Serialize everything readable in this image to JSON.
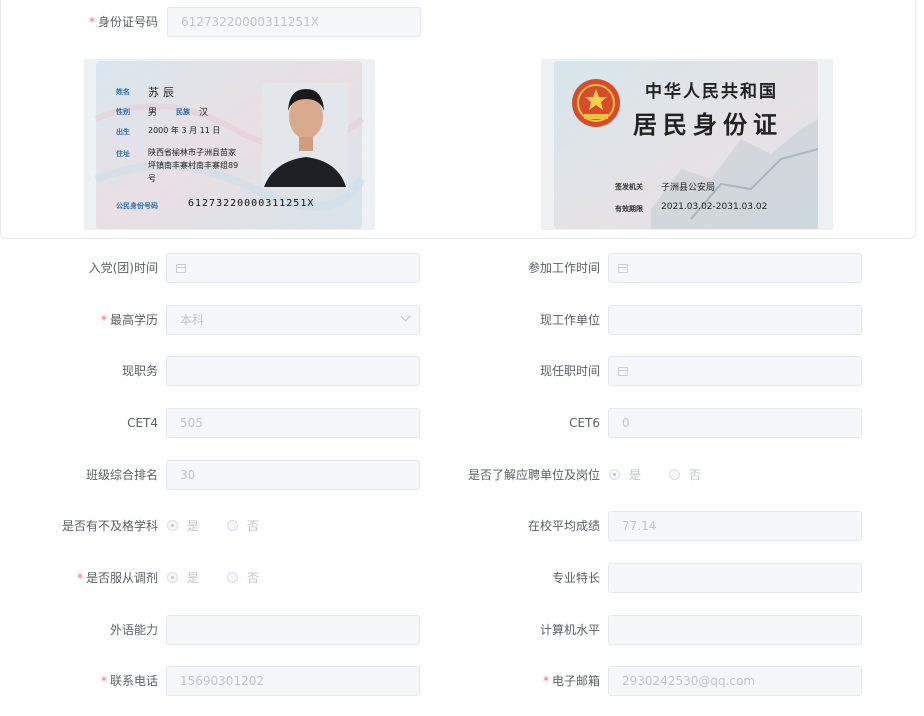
{
  "id_section": {
    "label": "身份证号码",
    "required": "*",
    "value": "61273220000311251X",
    "front": {
      "name_label": "姓名",
      "name": "苏辰",
      "gender_label": "性别",
      "gender": "男",
      "ethnic_label": "民族",
      "ethnic": "汉",
      "birth_label": "出生",
      "birth": "2000 年 3 月 11 日",
      "address_label": "住址",
      "address_1": "陕西省榆林市子洲县苗家",
      "address_2": "坪镇南丰寨村南丰寨组89",
      "address_3": "号",
      "idno_label": "公民身份号码",
      "idno": "61273220000311251X"
    },
    "back": {
      "title_1": "中华人民共和国",
      "title_2": "居民身份证",
      "issuer_label": "签发机关",
      "issuer": "子洲县公安局",
      "valid_label": "有效期限",
      "valid": "2021.03.02-2031.03.02"
    }
  },
  "form": {
    "join_party_time": {
      "label": "入党(团)时间",
      "value": ""
    },
    "work_start_time": {
      "label": "参加工作时间",
      "value": ""
    },
    "education": {
      "label": "最高学历",
      "required": "*",
      "value": "本科"
    },
    "current_employer": {
      "label": "现工作单位",
      "value": ""
    },
    "current_position": {
      "label": "现职务",
      "value": ""
    },
    "position_time": {
      "label": "现任职时间",
      "value": ""
    },
    "cet4": {
      "label": "CET4",
      "value": "505"
    },
    "cet6": {
      "label": "CET6",
      "value": "0"
    },
    "class_rank": {
      "label": "班级综合排名",
      "value": "30"
    },
    "understand_employer": {
      "label": "是否了解应聘单位及岗位",
      "yes": "是",
      "no": "否"
    },
    "failed_courses": {
      "label": "是否有不及格学科",
      "yes": "是",
      "no": "否"
    },
    "gpa": {
      "label": "在校平均成绩",
      "value": "77.14"
    },
    "accept_adjust": {
      "label": "是否服从调剂",
      "required": "*",
      "yes": "是",
      "no": "否"
    },
    "specialty": {
      "label": "专业特长",
      "value": ""
    },
    "language_ability": {
      "label": "外语能力",
      "value": ""
    },
    "computer_level": {
      "label": "计算机水平",
      "value": ""
    },
    "phone": {
      "label": "联系电话",
      "required": "*",
      "value": "15690301202"
    },
    "email": {
      "label": "电子邮箱",
      "required": "*",
      "value": "2930242530@qq.com"
    }
  }
}
